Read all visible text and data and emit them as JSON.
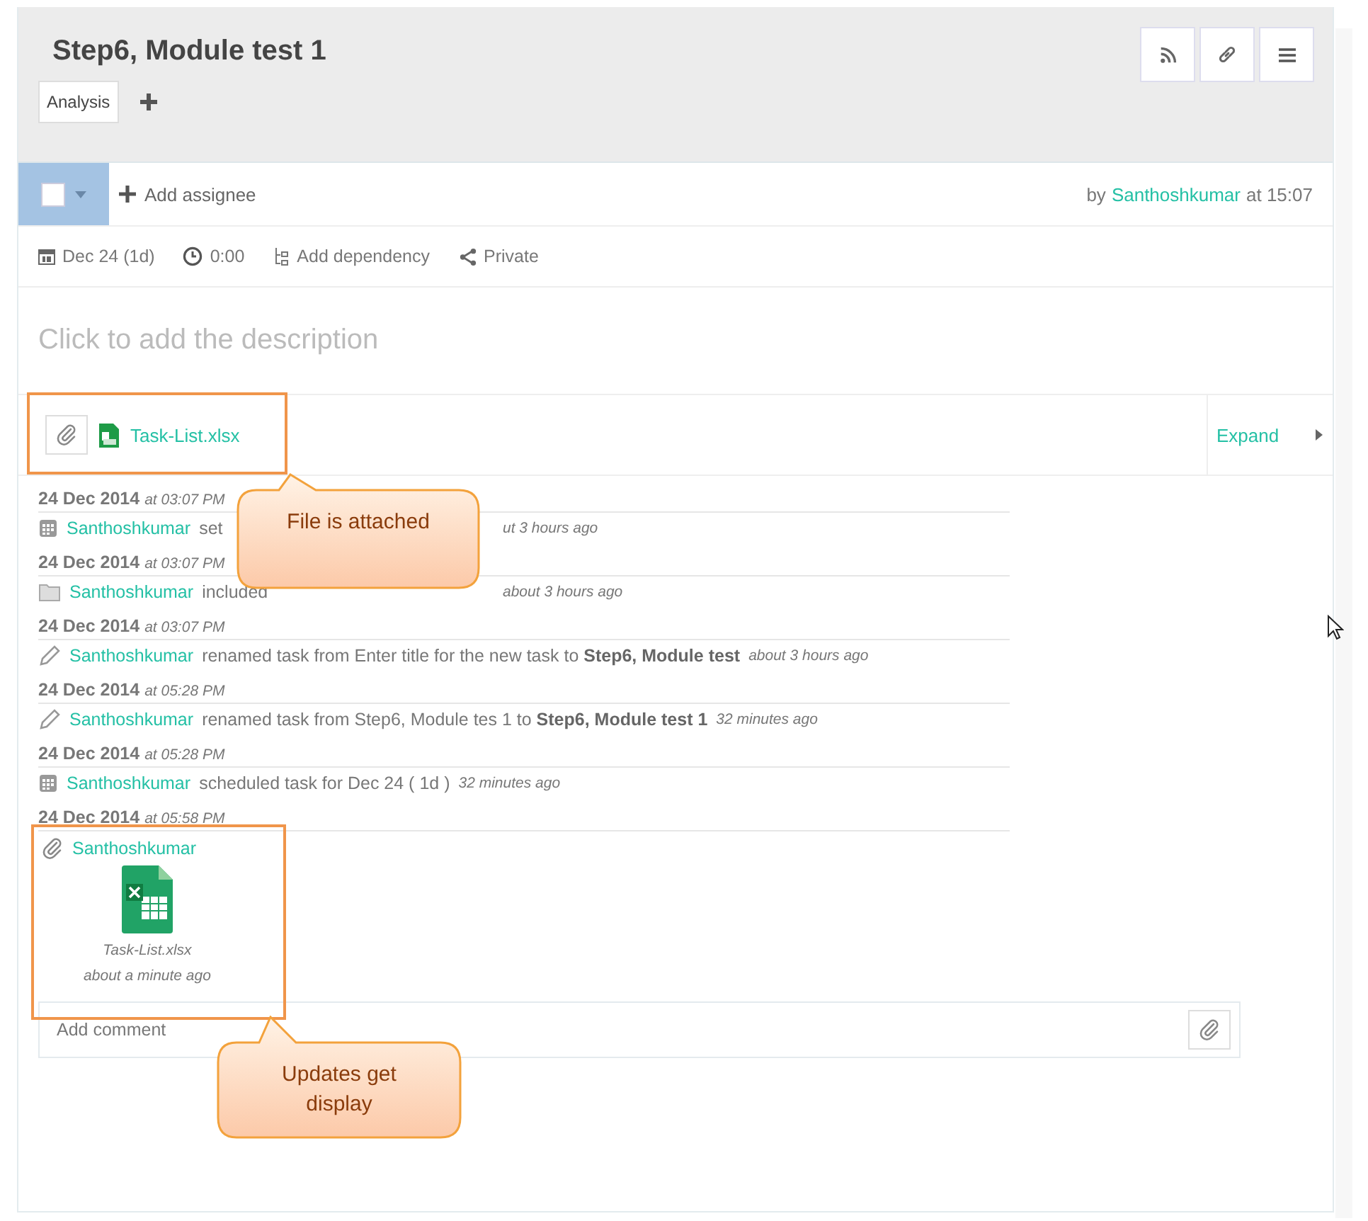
{
  "task": {
    "title": "Step6, Module test 1",
    "tags": [
      {
        "label": "Analysis"
      }
    ]
  },
  "toolbar": {
    "checked": false,
    "add_assignee": "Add assignee",
    "by": "by",
    "author": "Santhoshkumar",
    "at": "at 15:07"
  },
  "meta": [
    {
      "kind": "date",
      "label": "Dec 24 (1d)"
    },
    {
      "kind": "time",
      "label": "0:00"
    },
    {
      "kind": "dependency",
      "label": "Add dependency"
    },
    {
      "kind": "share",
      "label": "Private"
    }
  ],
  "description": {
    "placeholder": "Click to add the description"
  },
  "attachments": {
    "files": [
      {
        "name": "Task-List.xlsx"
      }
    ],
    "expand": "Expand"
  },
  "activity": [
    {
      "date": "24 Dec 2014",
      "time": "at 03:07 PM",
      "kind": "calendar",
      "user": "Santhoshkumar",
      "action": "set",
      "time_ago": "ut 3 hours ago",
      "covered": true
    },
    {
      "date": "24 Dec 2014",
      "time": "at 03:07 PM",
      "kind": "folder",
      "user": "Santhoshkumar",
      "action": "included",
      "time_ago": "about 3 hours ago",
      "covered": true
    },
    {
      "date": "24 Dec 2014",
      "time": "at 03:07 PM",
      "kind": "pencil",
      "user": "Santhoshkumar",
      "action": "renamed task from Enter title for the new task to **Step6, Module test**",
      "time_ago": "about 3 hours ago",
      "covered": false
    },
    {
      "date": "24 Dec 2014",
      "time": "at 05:28 PM",
      "kind": "pencil",
      "user": "Santhoshkumar",
      "action": "renamed task from Step6, Module tes 1 to **Step6, Module test 1**",
      "time_ago": "32 minutes ago",
      "covered": false
    },
    {
      "date": "24 Dec 2014",
      "time": "at 05:28 PM",
      "kind": "calendar",
      "user": "Santhoshkumar",
      "action": "scheduled task for Dec 24 ( 1d )",
      "time_ago": "32 minutes ago",
      "covered": false
    },
    {
      "date": "24 Dec 2014",
      "time": "at 05:58 PM",
      "kind": "attachment",
      "user": "Santhoshkumar",
      "file": "Task-List.xlsx",
      "time_ago": "about a minute ago"
    }
  ],
  "comment": {
    "placeholder": "Add comment"
  },
  "callouts": [
    {
      "text": "File is attached"
    },
    {
      "text": "Updates get display"
    }
  ]
}
